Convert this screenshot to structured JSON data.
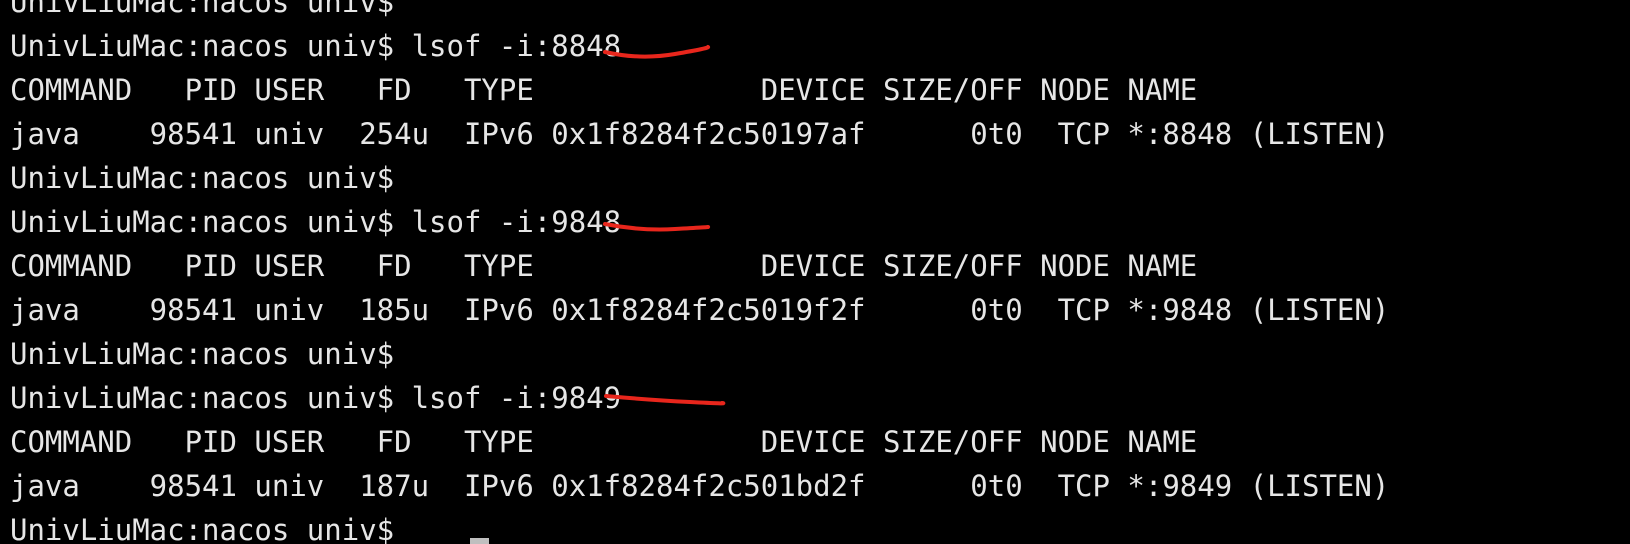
{
  "terminal": {
    "lines": [
      "UnivLiuMac:nacos univ$",
      "UnivLiuMac:nacos univ$ lsof -i:8848",
      "COMMAND   PID USER   FD   TYPE             DEVICE SIZE/OFF NODE NAME",
      "java    98541 univ  254u  IPv6 0x1f8284f2c50197af      0t0  TCP *:8848 (LISTEN)",
      "UnivLiuMac:nacos univ$",
      "UnivLiuMac:nacos univ$ lsof -i:9848",
      "COMMAND   PID USER   FD   TYPE             DEVICE SIZE/OFF NODE NAME",
      "java    98541 univ  185u  IPv6 0x1f8284f2c5019f2f      0t0  TCP *:9848 (LISTEN)",
      "UnivLiuMac:nacos univ$",
      "UnivLiuMac:nacos univ$ lsof -i:9849",
      "COMMAND   PID USER   FD   TYPE             DEVICE SIZE/OFF NODE NAME",
      "java    98541 univ  187u  IPv6 0x1f8284f2c501bd2f      0t0  TCP *:9849 (LISTEN)",
      "UnivLiuMac:nacos univ$"
    ]
  },
  "colors": {
    "background": "#000000",
    "text": "#e6e6e6",
    "annotation": "#e8261c",
    "cursor": "#bfbfbf"
  }
}
